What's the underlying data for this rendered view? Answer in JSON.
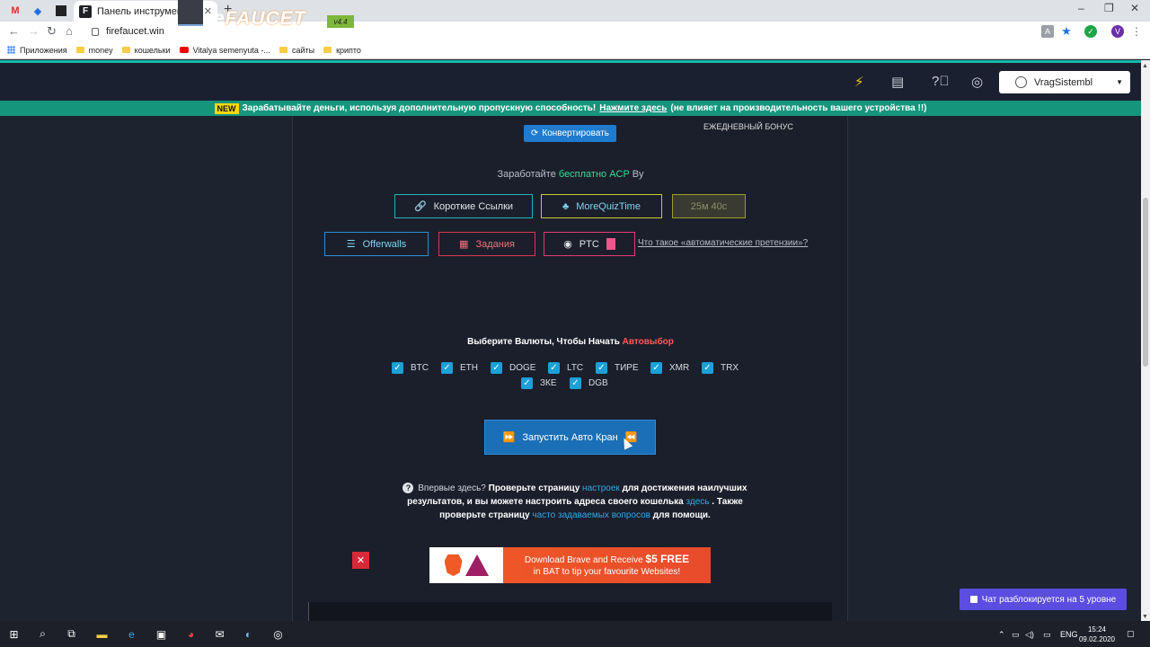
{
  "browser": {
    "active_tab_title": "Панель инструментов учетной",
    "url": "firefaucet.win",
    "bookmarks": [
      "Приложения",
      "money",
      "кошельки",
      "Vitalya semenyuta -...",
      "сайты",
      "крипто"
    ]
  },
  "site": {
    "logo_fire": "Fire",
    "logo_faucet": "FAUCET",
    "version": "v4.4",
    "username": "VragSistembl",
    "announce": {
      "badge": "NEW",
      "text_before": "Зарабатывайте деньги, используя дополнительную пропускную способность!",
      "link": "Нажмите здесь",
      "text_after": "(не влияет на производительность вашего устройства !!)"
    },
    "convert_label": "Конвертировать",
    "daily_bonus": "ЕЖЕДНЕВНЫЙ БОНУС",
    "earn": {
      "prefix": "Заработайте",
      "highlight": "бесплатно ACP",
      "suffix": "By"
    },
    "buttons": {
      "short_links": "Короткие Ссылки",
      "quiz": "MoreQuizTime",
      "timer": "25м 40с",
      "offerwalls": "Offerwalls",
      "tasks": "Задания",
      "ptc": "PTC"
    },
    "auto_claim_link": "Что такое «автоматические претензии»?",
    "select_title": "Выберите Валюты, Чтобы Начать",
    "select_auto": "Автовыбор",
    "coins": [
      "BTC",
      "ETH",
      "DOGE",
      "LTC",
      "ТИРЕ",
      "XMR",
      "TRX",
      "ЗКЕ",
      "DGB"
    ],
    "start_label": "Запустить Авто Кран",
    "help": {
      "q": "Впервые здесь?",
      "p1": "Проверьте страницу",
      "link1": "настроек",
      "p2": "для достижения наилучших результатов, и вы можете настроить адреса своего кошелька",
      "link2": "здесь",
      "p3": ". Также проверьте страницу",
      "link3": "часто задаваемых вопросов",
      "p4": "для помощи."
    },
    "ad": {
      "line1": "Download Brave and Receive",
      "amount": "$5 FREE",
      "line2": "in BAT to tip your favourite Websites!"
    },
    "chat_label": "Чат разблокируется на 5 уровне"
  },
  "taskbar": {
    "lang": "ENG",
    "time": "15:24",
    "date": "09.02.2020"
  }
}
